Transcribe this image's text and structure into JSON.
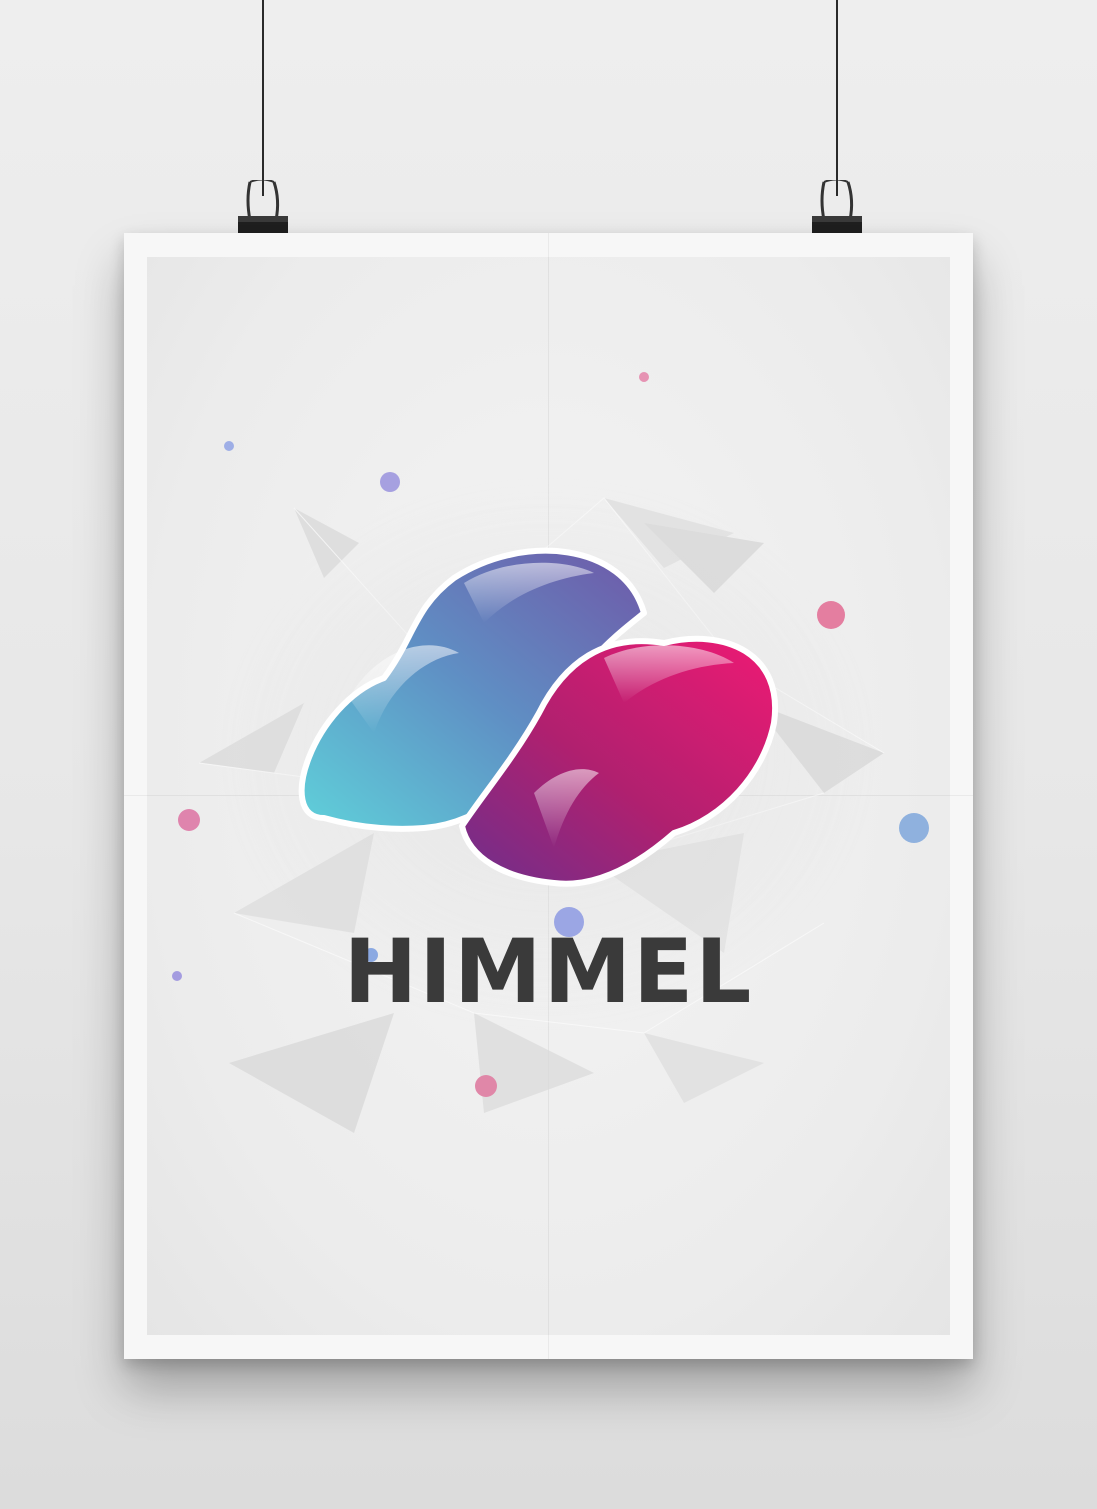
{
  "poster": {
    "brand_name": "HIMMEL"
  },
  "colors": {
    "background": "#e9e9e9",
    "poster_paper": "#f5f5f5",
    "logo_cyan": "#5cc8d6",
    "logo_blue_violet": "#6a6bb0",
    "logo_purple": "#7a3a95",
    "logo_magenta": "#e0146e",
    "wordmark": "#3a3a3a",
    "dot_pink": "#e07aa0",
    "dot_lilac": "#9a9ade",
    "dot_periwinkle": "#8ea7e0"
  },
  "icons": {
    "logo": "infinity-cloud-logo",
    "clips": "binder-clip-icon"
  }
}
